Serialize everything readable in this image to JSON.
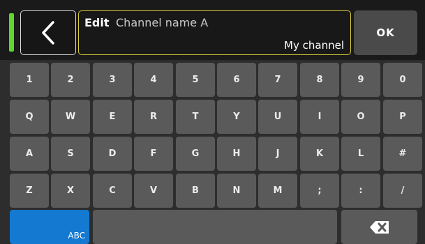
{
  "header": {
    "edit_prefix": "Edit",
    "edit_title": "Channel name A",
    "edit_value": "My channel",
    "ok_label": "OK",
    "back_icon": "chevron-left-icon"
  },
  "colors": {
    "indicator": "#5fd72a",
    "edit_border": "#d8cc3a",
    "abc_key": "#1379d1",
    "key_bg": "#5a5a5a"
  },
  "keyboard": {
    "rows": [
      [
        "1",
        "2",
        "3",
        "4",
        "5",
        "6",
        "7",
        "8",
        "9",
        "0"
      ],
      [
        "Q",
        "W",
        "E",
        "R",
        "T",
        "Y",
        "U",
        "I",
        "O",
        "P"
      ],
      [
        "A",
        "S",
        "D",
        "F",
        "G",
        "H",
        "J",
        "K",
        "L",
        "#"
      ],
      [
        "Z",
        "X",
        "C",
        "V",
        "B",
        "N",
        "M",
        ";",
        ":",
        "/"
      ]
    ],
    "abc_label": "ABC",
    "backspace_icon": "backspace-icon"
  }
}
